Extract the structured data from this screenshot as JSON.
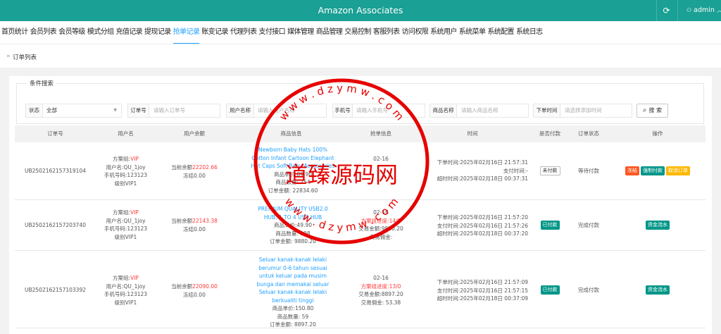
{
  "header": {
    "title": "Amazon Associates",
    "refresh_icon": "refresh-icon",
    "user_icon": "user-icon",
    "user_name": "admin",
    "chevron_icon": "chevron-up-icon"
  },
  "nav": {
    "items": [
      "首页统计",
      "会员列表",
      "会员等级",
      "模式分组",
      "充值记录",
      "提现记录",
      "抢单记录",
      "账变记录",
      "代理列表",
      "支付接口",
      "媒体管理",
      "商品管理",
      "交易控制",
      "客服列表",
      "访问权限",
      "系统用户",
      "系统菜单",
      "系统配置",
      "系统日志"
    ],
    "active_index": 6
  },
  "breadcrumb": {
    "separator": "»",
    "current": "订单列表"
  },
  "search": {
    "legend": "条件搜索",
    "status_label": "状态",
    "status_value": "全部",
    "order_label": "订单号",
    "order_placeholder": "请输入订单号",
    "user_label": "用户名称",
    "user_placeholder": "请输入用户名称",
    "phone_label": "手机号",
    "phone_placeholder": "请输入手机号",
    "product_label": "商品名称",
    "product_placeholder": "请输入商品名称",
    "time_label": "下单时间",
    "time_placeholder": "请选择添加时间",
    "search_button": "搜 索"
  },
  "table": {
    "headers": [
      "订单号",
      "用户名",
      "用户余额",
      "商品信息",
      "抢单信息",
      "时间",
      "是否付款",
      "订单状态",
      "操作"
    ],
    "rows": [
      {
        "order_no": "UB2502162157319104",
        "user": {
          "plan_label": "方案组:",
          "plan": "VIP",
          "name": "用户名:QU_1joy",
          "phone": "手机号码:123123",
          "level": "级别VIP1"
        },
        "balance": {
          "label": "当前余额",
          "amount": "22202.66",
          "frozen": "冻结0.00"
        },
        "product": {
          "name": "Newborn Baby Hats 100% Cotton Infant Cartoon Elephant Hat Caps Soft Baby Accessories",
          "price": "商品单价:89.90",
          "qty": "商品数量: 254",
          "total": "订单金额: 22834.60"
        },
        "grab": {
          "date": "02-16",
          "progress": "",
          "amount": "",
          "commission": ""
        },
        "time": {
          "order": "下单时间:2025年02月16日 21:57:31",
          "pay": "支付时间:-",
          "timeout": "超时时间:2025年02月18日 00:37:31"
        },
        "paid": "未付款",
        "status": "等待付款",
        "actions": [
          "冻结",
          "强制付款",
          "取消订单"
        ]
      },
      {
        "order_no": "UB2502162157203740",
        "user": {
          "plan_label": "方案组:",
          "plan": "VIP",
          "name": "用户名:QU_1joy",
          "phone": "手机号码:123123",
          "level": "级别VIP1"
        },
        "balance": {
          "label": "当前余额",
          "amount": "22143.38",
          "frozen": "冻结0.00"
        },
        "product": {
          "name": "PREMIUM QUALITY USB2.0 HUB. 1 TO 4 USB HUB",
          "price": "商品单价:49.90",
          "qty": "商品数量: 198",
          "total": "订单金额: 9880.20"
        },
        "grab": {
          "date": "02-16",
          "progress": "方案组进度:14/0",
          "amount": "交易金额:9880.20",
          "commission": "交易佣金:"
        },
        "time": {
          "order": "下单时间:2025年02月16日 21:57:20",
          "pay": "支付时间:2025年02月16日 21:57:26",
          "timeout": "超时时间:2025年02月18日 00:37:20"
        },
        "paid": "已付款",
        "status": "完成付款",
        "actions": [
          "资金流水"
        ]
      },
      {
        "order_no": "UB2502162157103392",
        "user": {
          "plan_label": "方案组:",
          "plan": "VIP",
          "name": "用户名:QU_1joy",
          "phone": "手机号码:123123",
          "level": "级别VIP1"
        },
        "balance": {
          "label": "当前余额",
          "amount": "22090.00",
          "frozen": "冻结0.00"
        },
        "product": {
          "name": "Seluar kanak-kanak lelaki berumur 0-6 tahun sesuai untuk keluar pada musim bunga dan memakai seluar Seluar kanak-kanak lelaki berkualiti tinggi",
          "price": "商品单价:150.80",
          "qty": "商品数量: 59",
          "total": "订单金额: 8897.20"
        },
        "grab": {
          "date": "02-16",
          "progress": "方案组进度:13/0",
          "amount": "交易金额:8897.20",
          "commission": "交易佣金: 53.38"
        },
        "time": {
          "order": "下单时间:2025年02月16日 21:57:09",
          "pay": "支付时间:2025年02月16日 21:57:15",
          "timeout": "超时时间:2025年02月18日 00:37:09"
        },
        "paid": "已付款",
        "status": "完成付款",
        "actions": [
          "资金流水"
        ]
      }
    ]
  },
  "watermark": {
    "center_text": "道臻源码网",
    "ring_top": "w w w . d z y m w . c o m",
    "ring_bottom": "w w w . d z y m w . c o m",
    "color": "#e60000"
  }
}
